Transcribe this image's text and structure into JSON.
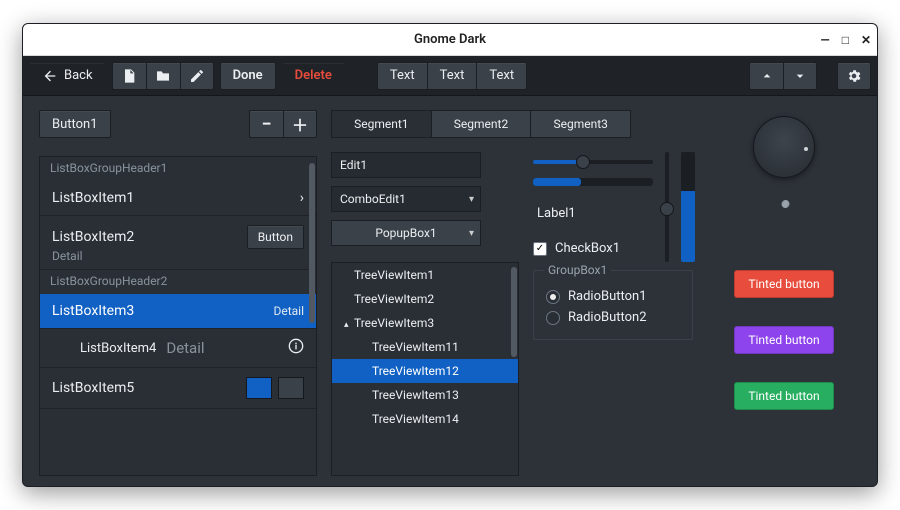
{
  "window": {
    "title": "Gnome Dark"
  },
  "toolbar": {
    "back": "Back",
    "done": "Done",
    "delete": "Delete",
    "text": "Text"
  },
  "left": {
    "button1": "Button1",
    "groups": [
      {
        "header": "ListBoxGroupHeader1"
      },
      {
        "header": "ListBoxGroupHeader2"
      }
    ],
    "items": {
      "i1": {
        "label": "ListBoxItem1"
      },
      "i2": {
        "label": "ListBoxItem2",
        "detail": "Detail",
        "button": "Button"
      },
      "i3": {
        "label": "ListBoxItem3",
        "detail": "Detail"
      },
      "i4": {
        "label": "ListBoxItem4",
        "detail": "Detail"
      },
      "i5": {
        "label": "ListBoxItem5"
      }
    }
  },
  "segments": [
    "Segment1",
    "Segment2",
    "Segment3"
  ],
  "mid": {
    "edit": "Edit1",
    "combo": "ComboEdit1",
    "popup": "PopupBox1",
    "tree": {
      "i1": "TreeViewItem1",
      "i2": "TreeViewItem2",
      "i3": "TreeViewItem3",
      "i11": "TreeViewItem11",
      "i12": "TreeViewItem12",
      "i13": "TreeViewItem13",
      "i14": "TreeViewItem14"
    }
  },
  "right": {
    "slider_h_pct": 42,
    "progress_pct": 40,
    "slider_v_pct": 48,
    "level_pct": 65,
    "label1": "Label1",
    "checkbox1": "CheckBox1",
    "groupbox_title": "GroupBox1",
    "radio1": "RadioButton1",
    "radio2": "RadioButton2"
  },
  "tinted": {
    "red": {
      "label": "Tinted button",
      "color": "#e74c3c"
    },
    "violet": {
      "label": "Tinted button",
      "color": "#8e44ec"
    },
    "green": {
      "label": "Tinted button",
      "color": "#27ae60"
    }
  },
  "colors": {
    "accent": "#1061c3",
    "swatch1": "#1061c3",
    "swatch2": "#3a4149"
  }
}
